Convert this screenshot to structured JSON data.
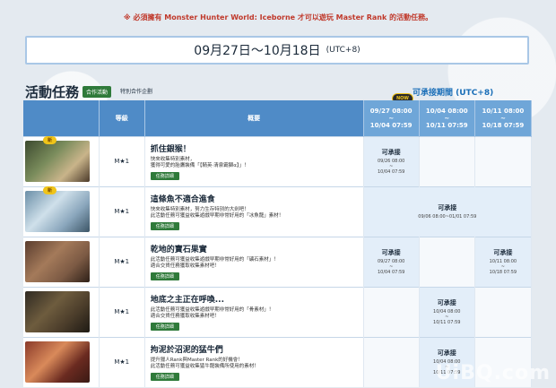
{
  "notice": "※ 必須擁有 Monster Hunter World: Iceborne 才可以遊玩 Master Rank 的活動任務。",
  "period": {
    "dates": "09月27日～10月18日",
    "tz": "(UTC+8)"
  },
  "section": {
    "title": "活動任務",
    "coop_tag": "合作活動",
    "special_tag": "特別合作企劃",
    "available_label": "可承接期間 (UTC+8)"
  },
  "now_badge": "NOW",
  "columns": {
    "level": "等級",
    "summary": "概要",
    "week1": "09/27 08:00\n~\n10/04 07:59",
    "week2": "10/04 08:00\n~\n10/11 07:59",
    "week3": "10/11 08:00\n~\n10/18 07:59"
  },
  "new_label": "新",
  "detail_label": "任務詳細",
  "quests": [
    {
      "rank": "M★1",
      "is_new": true,
      "title": "抓住銀猴！",
      "line1": "快來收集特別素材，",
      "line2": "獲得可愛的胎鷹裝備「【騎英‧清泉霸獅α】」！",
      "sched": {
        "title": "可承接",
        "l1": "09/26 08:00",
        "l2": "~",
        "l3": "10/04 07:59"
      }
    },
    {
      "rank": "M★1",
      "is_new": true,
      "title": "這條魚不適合進食",
      "line1": "快來收集特別素材，努力生存特別的大劍吧！",
      "line2": "此活動任務可獲益收集遊戲早期非常好用的「冰魚龍」素材！",
      "sched": {
        "title": "可承接",
        "l1": "09/06 08:00~01/01 07:59",
        "l2": "",
        "l3": ""
      }
    },
    {
      "rank": "M★1",
      "is_new": false,
      "title": "乾地的寶石果實",
      "line1": "此活動任務可獲益收集遊戲早期非常好用的「礦石素材」！",
      "line2": "適合交貨任務獲取收集素材吧！",
      "sched": {
        "title": "可承接",
        "l1": "09/27 08:00",
        "l2": "~",
        "l3": "10/04 07:59"
      },
      "sched3": {
        "title": "可承接",
        "l1": "10/11 08:00",
        "l2": "~",
        "l3": "10/18 07:59"
      }
    },
    {
      "rank": "M★1",
      "is_new": false,
      "title": "地底之主正在呼喚...",
      "line1": "此活動任務可獲益收集遊戲早期非常好用的「骨素材」！",
      "line2": "適合交貨任務獲取收集素材吧！",
      "sched": {
        "title": "可承接",
        "l1": "10/04 08:00",
        "l2": "~",
        "l3": "10/11 07:59"
      }
    },
    {
      "rank": "M★1",
      "is_new": false,
      "title": "拘泥於沼泥的猛牛們",
      "line1": "提升獵人Rank與Master Rank的好機會！",
      "line2": "此活動任務可獲益收集猛牛龍裝備所使用的素材！",
      "sched": {
        "title": "可承接",
        "l1": "10/04 08:00",
        "l2": "~",
        "l3": "10/11 07:59"
      }
    }
  ],
  "watermark": "UiBQ.com"
}
